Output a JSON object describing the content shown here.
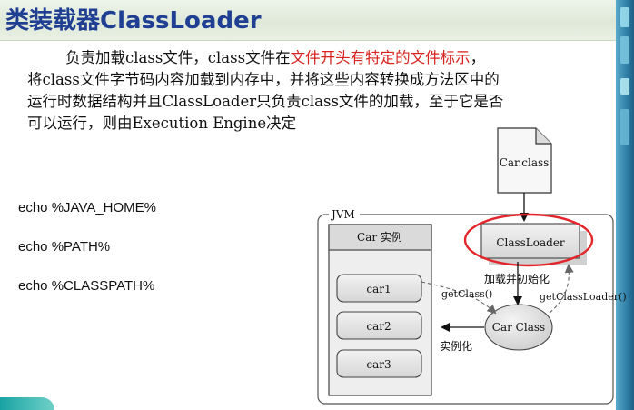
{
  "header": {
    "title": "类装载器ClassLoader"
  },
  "paragraph": {
    "line1_a": "负责加载class文件，class文件在",
    "line1_highlight": "文件开头有特定的文件标示",
    "line1_b": "，",
    "line2": "将class文件字节码内容加载到内存中，并将这些内容转换成方法区中的",
    "line3": "运行时数据结构并且ClassLoader只负责class文件的加载，至于它是否",
    "line4": "可以运行，则由Execution Engine决定"
  },
  "commands": [
    "echo %JAVA_HOME%",
    "echo %PATH%",
    "echo %CLASSPATH%"
  ],
  "diagram": {
    "file_label": "Car.class",
    "jvm_label": "JVM",
    "instance_header": "Car 实例",
    "instances": [
      "car1",
      "car2",
      "car3"
    ],
    "classloader_label": "ClassLoader",
    "load_init_label": "加载并初始化",
    "getclass_label": "getClass()",
    "getclassloader_label": "getClassLoader()",
    "carclass_label": "Car Class",
    "instantiate_label": "实例化"
  },
  "colors": {
    "title": "#1f3f93",
    "highlight": "#d8231e",
    "circle": "#e3262c"
  }
}
